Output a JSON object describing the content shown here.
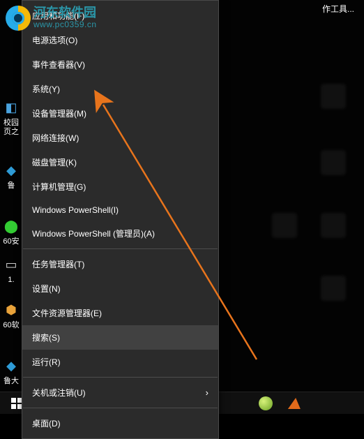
{
  "watermark": {
    "title": "河东软件园",
    "url": "www.pc0359.cn"
  },
  "title_fragment": "作工具...",
  "desktop_icons": {
    "i1": "校园页之",
    "i2": "鲁",
    "i3": "60安",
    "i4a": "1.",
    "i5": "60软",
    "i6": "鲁大"
  },
  "menu": {
    "items": [
      "应用和功能(F)",
      "电源选项(O)",
      "事件查看器(V)",
      "系统(Y)",
      "设备管理器(M)",
      "网络连接(W)",
      "磁盘管理(K)",
      "计算机管理(G)",
      "Windows PowerShell(I)",
      "Windows PowerShell (管理员)(A)"
    ],
    "items2": [
      "任务管理器(T)",
      "设置(N)",
      "文件资源管理器(E)",
      "搜索(S)",
      "运行(R)"
    ],
    "items3": [
      "关机或注销(U)"
    ],
    "items4": [
      "桌面(D)"
    ]
  }
}
